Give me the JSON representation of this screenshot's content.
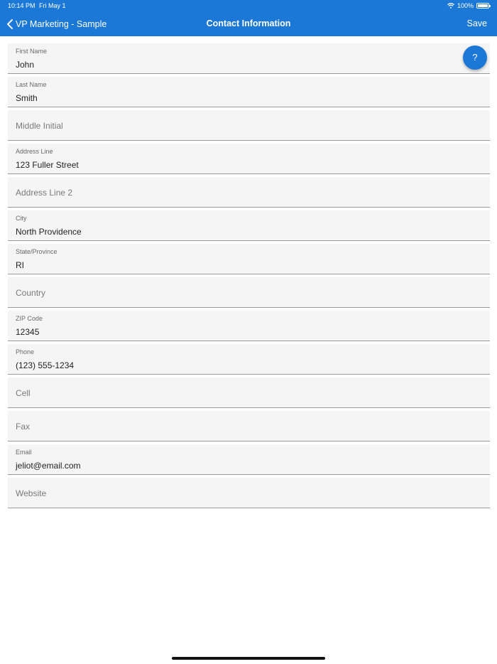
{
  "status_bar": {
    "time": "10:14 PM",
    "date": "Fri May 1",
    "battery": "100%",
    "wifi_icon": "wifi-icon",
    "battery_icon": "battery-icon"
  },
  "nav": {
    "back_label": "VP Marketing - Sample",
    "title": "Contact Information",
    "save_label": "Save",
    "back_icon": "chevron-left-icon"
  },
  "help_button": {
    "label": "?"
  },
  "colors": {
    "accent": "#1b78d6",
    "field_bg": "#f5f5f5"
  },
  "fields": [
    {
      "label": "First Name",
      "value": "John",
      "placeholder": ""
    },
    {
      "label": "Last Name",
      "value": "Smith",
      "placeholder": ""
    },
    {
      "label": "",
      "value": "",
      "placeholder": "Middle Initial"
    },
    {
      "label": "Address Line",
      "value": "123 Fuller Street",
      "placeholder": ""
    },
    {
      "label": "",
      "value": "",
      "placeholder": "Address Line 2"
    },
    {
      "label": "City",
      "value": "North Providence",
      "placeholder": ""
    },
    {
      "label": "State/Province",
      "value": "RI",
      "placeholder": ""
    },
    {
      "label": "",
      "value": "",
      "placeholder": "Country"
    },
    {
      "label": "ZIP Code",
      "value": "12345",
      "placeholder": ""
    },
    {
      "label": "Phone",
      "value": "(123) 555-1234",
      "placeholder": ""
    },
    {
      "label": "",
      "value": "",
      "placeholder": "Cell"
    },
    {
      "label": "",
      "value": "",
      "placeholder": "Fax"
    },
    {
      "label": "Email",
      "value": "jeliot@email.com",
      "placeholder": ""
    },
    {
      "label": "",
      "value": "",
      "placeholder": "Website"
    }
  ]
}
